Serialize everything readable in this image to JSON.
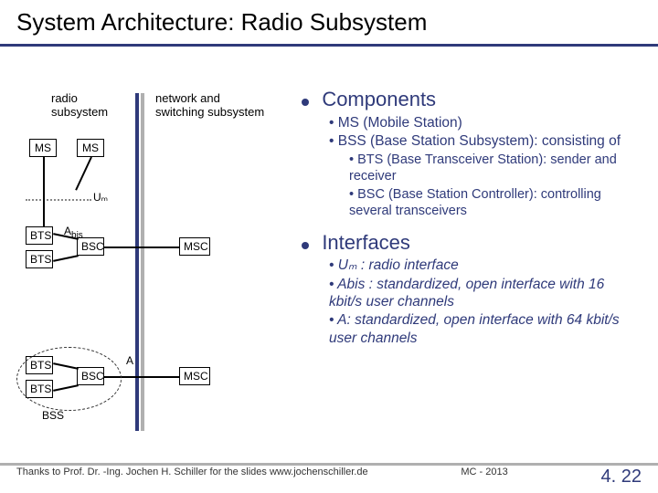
{
  "title": "System Architecture: Radio Subsystem",
  "diagram": {
    "col_left": "radio subsystem",
    "col_right": "network and switching subsystem",
    "ms": "MS",
    "bts": "BTS",
    "bsc": "BSC",
    "msc": "MSC",
    "um": "Uₘ",
    "abis": "Abis",
    "a": "A",
    "bss": "BSS"
  },
  "right": {
    "h1": "Components",
    "c1": "MS (Mobile Station)",
    "c2": "BSS (Base Station Subsystem): consisting of",
    "c2a": "BTS (Base Transceiver Station): sender and receiver",
    "c2b": "BSC (Base Station Controller): controlling several transceivers",
    "h2": "Interfaces",
    "i1": "Uₘ : radio interface",
    "i2": "Abis : standardized, open interface with 16 kbit/s user channels",
    "i3": "A: standardized, open interface with 64 kbit/s user channels"
  },
  "footer": {
    "left": "Thanks to Prof. Dr. -Ing. Jochen H. Schiller for the slides  www.jochenschiller.de",
    "mid": "MC - 2013",
    "page": "4. 22"
  }
}
